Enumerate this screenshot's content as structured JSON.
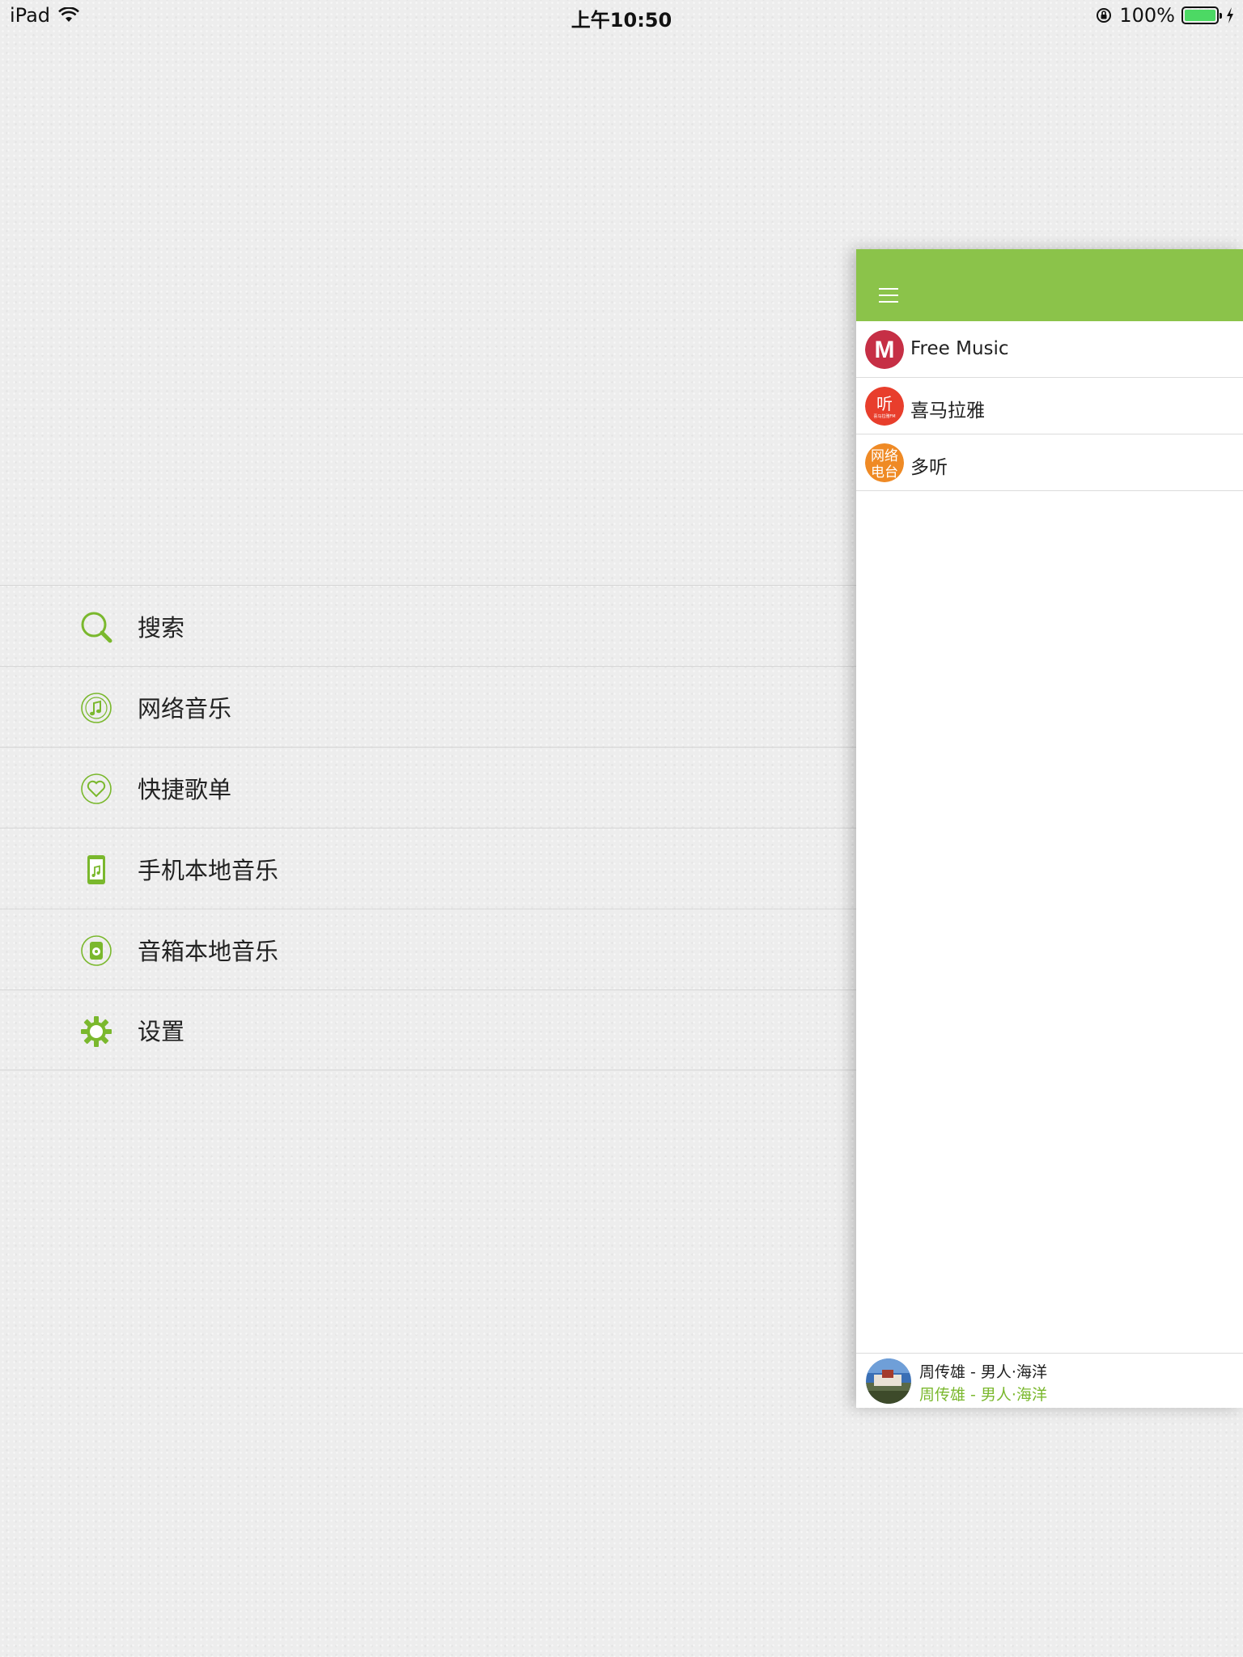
{
  "status_bar": {
    "device": "iPad",
    "time": "上午10:50",
    "battery": "100%",
    "battery_level": 1.0,
    "icons": [
      "wifi-icon",
      "rotation-lock-icon",
      "battery-icon",
      "charging-icon"
    ]
  },
  "colors": {
    "accent": "#8bc34a",
    "accent_text": "#7ab82d",
    "logo_free_music": "#c62f45",
    "logo_ximalaya": "#e83e2c",
    "logo_duoting": "#ef8a25"
  },
  "menu": {
    "items": [
      {
        "label": "搜索",
        "icon": "search-icon"
      },
      {
        "label": "网络音乐",
        "icon": "online-music-icon"
      },
      {
        "label": "快捷歌单",
        "icon": "heart-playlist-icon"
      },
      {
        "label": "手机本地音乐",
        "icon": "phone-music-icon"
      },
      {
        "label": "音箱本地音乐",
        "icon": "speaker-music-icon"
      },
      {
        "label": "设置",
        "icon": "gear-icon"
      }
    ]
  },
  "panel": {
    "header_icon": "hamburger-menu-icon",
    "sources": [
      {
        "name": "Free Music",
        "logo_text": "M"
      },
      {
        "name": "喜马拉雅",
        "logo_text": "听",
        "logo_subtext": "喜马拉雅FM"
      },
      {
        "name": "多听",
        "logo_text": "网络电台"
      }
    ],
    "now_playing": {
      "line1": "周传雄 - 男人·海洋",
      "line2": "周传雄 - 男人·海洋"
    }
  }
}
